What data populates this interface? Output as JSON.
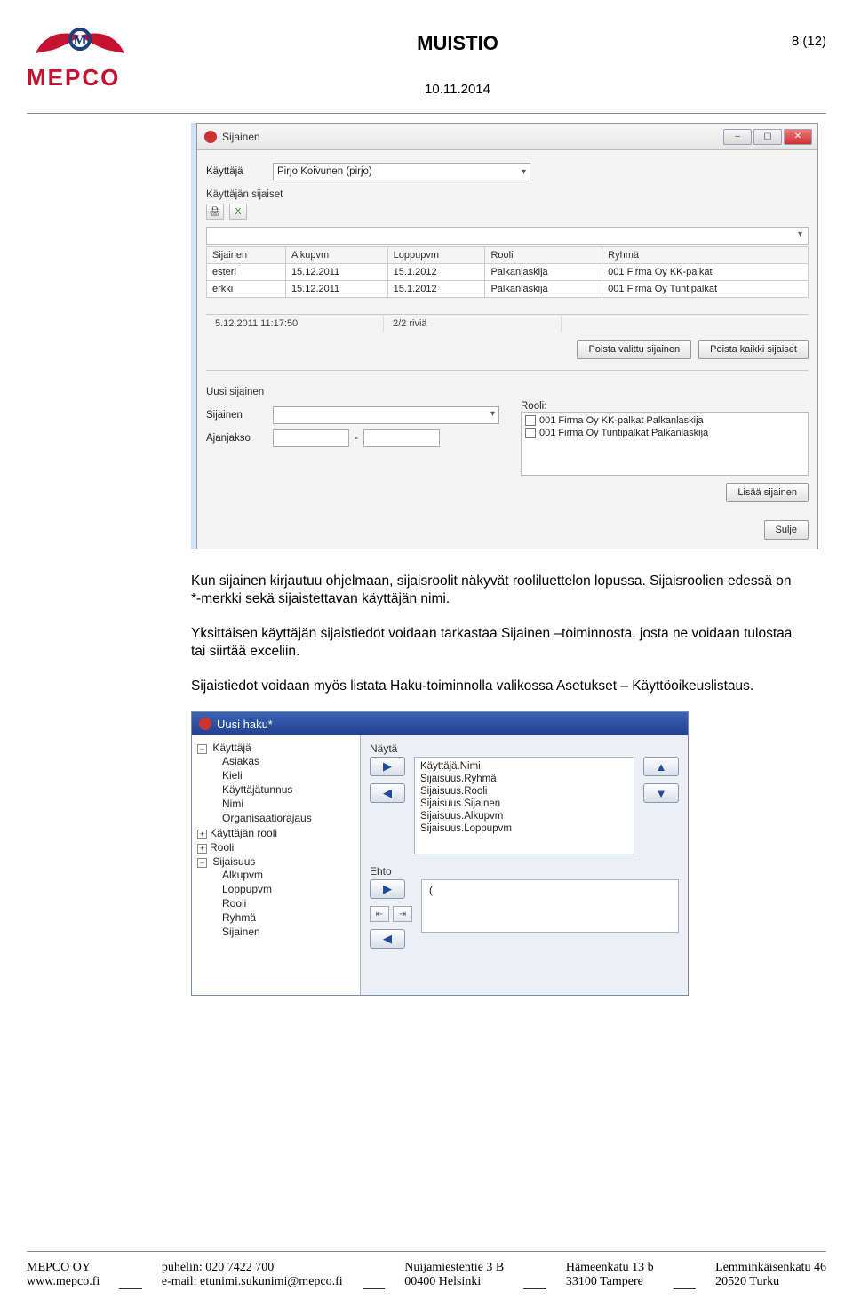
{
  "doc": {
    "title": "MUISTIO",
    "date": "10.11.2014",
    "page": "8 (12)"
  },
  "dialog1": {
    "title": "Sijainen",
    "user_label": "Käyttäjä",
    "user_value": "Pirjo Koivunen (pirjo)",
    "section_label": "Käyttäjän sijaiset",
    "columns": [
      "Sijainen",
      "Alkupvm",
      "Loppupvm",
      "Rooli",
      "Ryhmä"
    ],
    "rows": [
      [
        "esteri",
        "15.12.2011",
        "15.1.2012",
        "Palkanlaskija",
        "001 Firma Oy KK-palkat"
      ],
      [
        "erkki",
        "15.12.2011",
        "15.1.2012",
        "Palkanlaskija",
        "001 Firma Oy Tuntipalkat"
      ]
    ],
    "status_ts": "5.12.2011 11:17:50",
    "status_rows": "2/2 riviä",
    "btn_remove_selected": "Poista valittu sijainen",
    "btn_remove_all": "Poista kaikki sijaiset",
    "new_section": "Uusi sijainen",
    "lbl_sijainen": "Sijainen",
    "lbl_ajanjakso": "Ajanjakso",
    "lbl_rooli": "Rooli:",
    "roles": [
      "001 Firma Oy KK-palkat Palkanlaskija",
      "001 Firma Oy Tuntipalkat Palkanlaskija"
    ],
    "btn_add": "Lisää sijainen",
    "btn_close": "Sulje"
  },
  "para1": "Kun sijainen kirjautuu ohjelmaan, sijaisroolit näkyvät rooliluettelon lopussa. Sijaisroolien edessä on *-merkki sekä sijaistettavan käyttäjän nimi.",
  "para2": "Yksittäisen käyttäjän sijaistiedot voidaan tarkastaa Sijainen –toiminnosta, josta ne voidaan tulostaa tai siirtää exceliin.",
  "para3": "Sijaistiedot voidaan myös listata Haku-toiminnolla valikossa Asetukset – Käyttöoikeuslistaus.",
  "dialog2": {
    "title": "Uusi haku*",
    "tree_root": "Käyttäjä",
    "tree_children": [
      "Asiakas",
      "Kieli",
      "Käyttäjätunnus",
      "Nimi",
      "Organisaatiorajaus"
    ],
    "tree_siblings": [
      "Käyttäjän rooli",
      "Rooli"
    ],
    "tree_sijaisuus": "Sijaisuus",
    "tree_sijaisuus_children": [
      "Alkupvm",
      "Loppupvm",
      "Rooli",
      "Ryhmä",
      "Sijainen"
    ],
    "nayta_label": "Näytä",
    "fields": [
      "Käyttäjä.Nimi",
      "Sijaisuus.Ryhmä",
      "Sijaisuus.Rooli",
      "Sijaisuus.Sijainen",
      "Sijaisuus.Alkupvm",
      "Sijaisuus.Loppupvm"
    ],
    "ehto_label": "Ehto",
    "ehto_text": "("
  },
  "footer": {
    "c1a": "MEPCO OY",
    "c1b": "www.mepco.fi",
    "c2a": "puhelin: 020 7422 700",
    "c2b": "e-mail: etunimi.sukunimi@mepco.fi",
    "c3a": "Nuijamiestentie 3 B",
    "c3b": "00400 Helsinki",
    "c4a": "Hämeenkatu 13 b",
    "c4b": "33100 Tampere",
    "c5a": "Lemminkäisenkatu 46",
    "c5b": "20520 Turku"
  }
}
